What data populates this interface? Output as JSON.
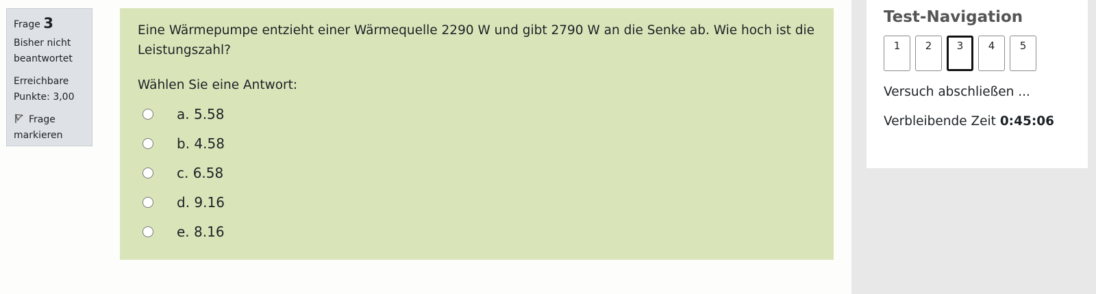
{
  "question_info": {
    "label": "Frage",
    "number": "3",
    "status": "Bisher nicht beantwortet",
    "points": "Erreichbare Punkte: 3,00",
    "flag_label": "Frage markieren",
    "flag_icon": "flag-icon"
  },
  "question": {
    "text": "Eine Wärmepumpe entzieht einer Wärmequelle 2290 W und gibt 2790 W an die Senke ab. Wie hoch ist die Leistungszahl?",
    "prompt": "Wählen Sie eine Antwort:",
    "answers": [
      {
        "label": "a. 5.58"
      },
      {
        "label": "b. 4.58"
      },
      {
        "label": "c. 6.58"
      },
      {
        "label": "d. 9.16"
      },
      {
        "label": "e. 8.16"
      }
    ]
  },
  "navigation": {
    "title": "Test-Navigation",
    "buttons": [
      "1",
      "2",
      "3",
      "4",
      "5"
    ],
    "current": "3",
    "finish_label": "Versuch abschließen ...",
    "timer_label": "Verbleibende Zeit",
    "timer_value": "0:45:06"
  },
  "colors": {
    "question_bg": "#d9e5b9",
    "info_bg": "#dee2e6",
    "nav_bg": "#ffffff",
    "sidebar_bg": "#e8e8e8"
  }
}
